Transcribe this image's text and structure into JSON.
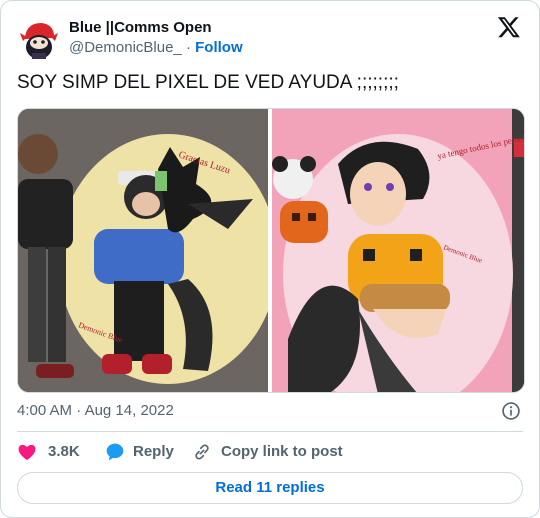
{
  "author": {
    "display_name": "Blue ||Comms Open",
    "handle": "@DemonicBlue_",
    "separator": "·",
    "follow_label": "Follow"
  },
  "tweet": {
    "text": "SOY SIMP DEL PIXEL DE VED AYUDA ;;;;;;;;"
  },
  "media": {
    "left_image": {
      "signature": "Demonic Blue",
      "note": "Gracias Luzu"
    },
    "right_image": {
      "note": "ya tengo todos los peluches",
      "signature": "Demonic Blue"
    }
  },
  "meta": {
    "time": "4:00 AM",
    "separator": "·",
    "date": "Aug 14, 2022"
  },
  "actions": {
    "likes": "3.8K",
    "reply_label": "Reply",
    "copy_label": "Copy link to post"
  },
  "read_replies_label": "Read 11 replies",
  "colors": {
    "like": "#f91880",
    "reply": "#1d9bf0",
    "link": "#006fd6",
    "secondary_text": "#536471",
    "border": "#cfd9de"
  },
  "icons": [
    "x-logo-icon",
    "info-icon",
    "heart-icon",
    "reply-bubble-icon",
    "link-icon"
  ]
}
